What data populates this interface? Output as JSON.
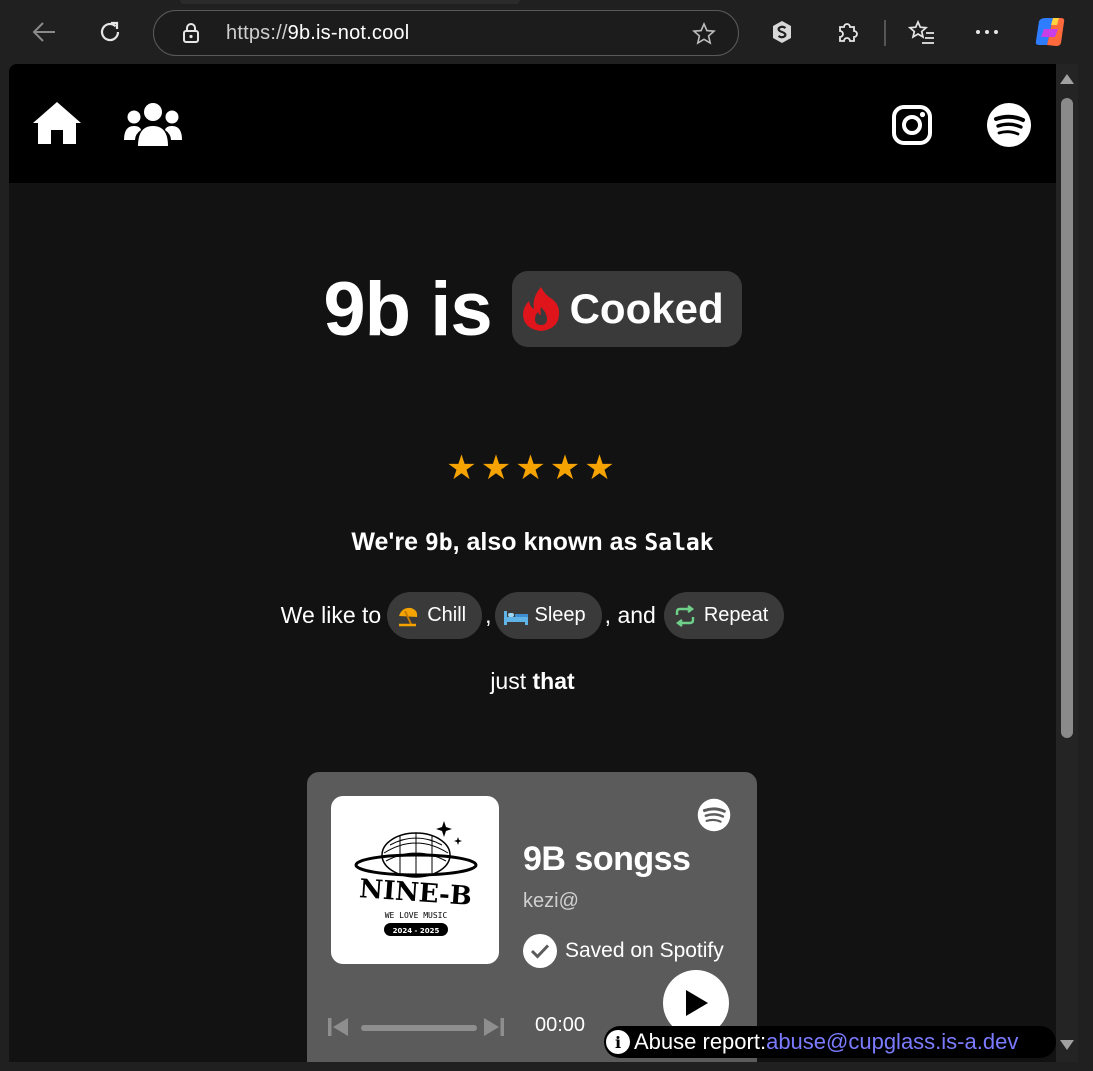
{
  "browser": {
    "url_scheme": "https://",
    "url_host": "9b.is-not.cool",
    "icons": [
      "back-arrow-icon",
      "refresh-icon",
      "lock-icon",
      "favorite-star-icon",
      "extension-s-icon",
      "extensions-puzzle-icon",
      "favorites-list-icon",
      "more-dots-icon",
      "copilot-icon"
    ]
  },
  "nav": {
    "left_icons": [
      "home-icon",
      "group-icon"
    ],
    "right_icons": [
      "instagram-icon",
      "spotify-icon"
    ]
  },
  "hero": {
    "title": "9b is",
    "status_label": "Cooked",
    "status_icon": "flame-icon",
    "status_color": "#e0151b"
  },
  "rating": {
    "stars": "★★★★★",
    "value": 5,
    "max": 5,
    "color": "#f5a300"
  },
  "intro": {
    "prefix": "We're ",
    "name": "9b",
    "middle": ", also known as ",
    "alias": "Salak"
  },
  "likes": {
    "prefix": "We like to",
    "sep1": ",",
    "sep2": ", and",
    "chips": [
      {
        "label": "Chill",
        "icon": "beach-umbrella-icon"
      },
      {
        "label": "Sleep",
        "icon": "bed-icon"
      },
      {
        "label": "Repeat",
        "icon": "repeat-icon"
      }
    ]
  },
  "tagline": {
    "prefix": "just ",
    "emphasis": "that"
  },
  "spotify_embed": {
    "cover_text": "NINE-B",
    "cover_subtext": "WE LOVE MUSIC",
    "cover_years": "2024 - 2025",
    "title": "9B songss",
    "author": "kezi@",
    "saved_label": "Saved on Spotify",
    "time": "00:00",
    "more": "•••",
    "progress": 0
  },
  "abuse": {
    "label": "Abuse report:",
    "email": "abuse@cupglass.is-a.dev"
  }
}
